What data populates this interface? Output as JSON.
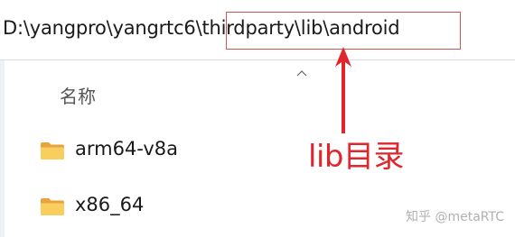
{
  "address_bar": {
    "path": "D:\\yangpro\\yangrtc6\\thirdparty\\lib\\android"
  },
  "file_list": {
    "sort_icon": "chevron-up-icon",
    "column_header": "名称",
    "items": [
      {
        "name": "arm64-v8a",
        "icon": "folder-icon"
      },
      {
        "name": "x86_64",
        "icon": "folder-icon"
      }
    ]
  },
  "annotation": {
    "label": "lib目录",
    "color": "#e0252b",
    "highlight_color": "#d9534f"
  },
  "watermark": {
    "text": "知乎 @metaRTC"
  }
}
